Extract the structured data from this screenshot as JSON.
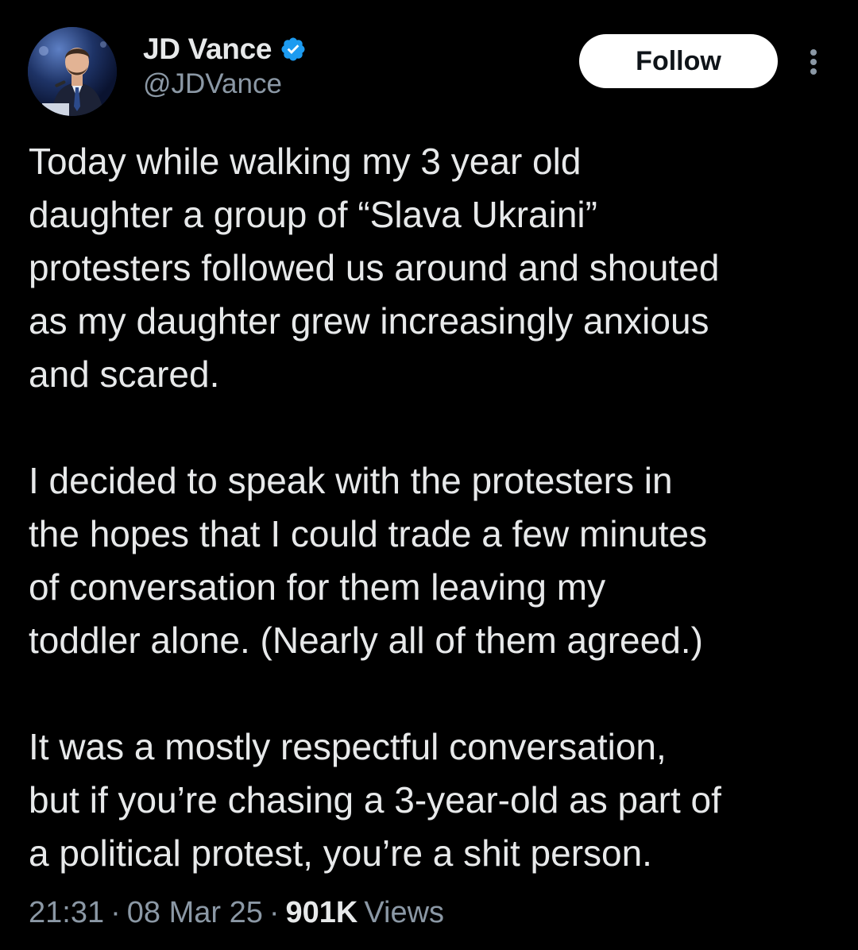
{
  "author": {
    "display_name": "JD Vance",
    "handle": "@JDVance",
    "verified": true,
    "verified_badge_color": "#1d9bf0",
    "avatar_icon": "profile-photo"
  },
  "actions": {
    "follow_label": "Follow",
    "more_icon": "more-vertical-icon"
  },
  "tweet": {
    "paragraphs": [
      "Today while walking my 3 year old\ndaughter a group of “Slava Ukraini”\nprotesters followed us around and shouted\nas my daughter grew increasingly anxious\nand scared.",
      "I decided to speak with the protesters in\nthe hopes that I could trade a few minutes\nof conversation for them leaving my\ntoddler alone. (Nearly all of them agreed.)",
      "It was a mostly respectful conversation,\nbut if you’re chasing a 3-year-old as part of\na political protest, you’re a shit person."
    ]
  },
  "meta": {
    "time": "21:31",
    "separator": "·",
    "date": "08 Mar 25",
    "views_count": "901K",
    "views_label": "Views"
  },
  "colors": {
    "background": "#000000",
    "primary_text": "#e7e9ea",
    "secondary_text": "#8b98a5",
    "follow_bg": "#ffffff",
    "follow_text": "#0f1419"
  }
}
